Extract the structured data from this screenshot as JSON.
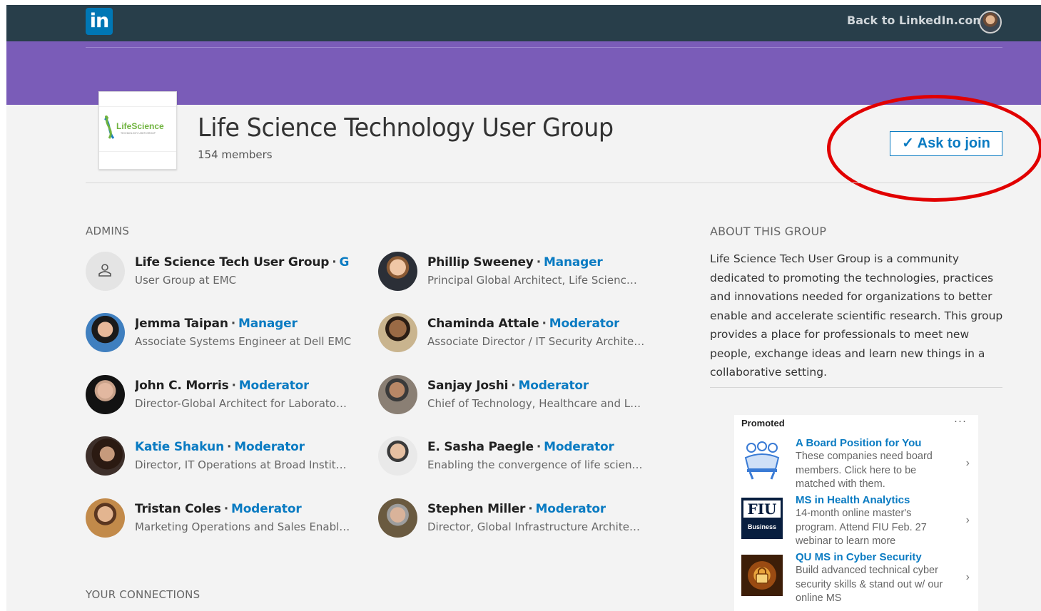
{
  "topbar": {
    "logo_text": "in",
    "back_link": "Back to LinkedIn.com"
  },
  "group": {
    "name": "Life Science Technology User Group",
    "members": "154 members",
    "join_button": "✓ Ask to join"
  },
  "sections": {
    "admins": "ADMINS",
    "about": "ABOUT THIS GROUP",
    "connections": "YOUR CONNECTIONS"
  },
  "admins": [
    {
      "name": "Life Science Tech User Group",
      "role": "Gro",
      "headline": "User Group at EMC"
    },
    {
      "name": "Phillip Sweeney",
      "role": "Manager",
      "headline": "Principal Global Architect, Life Scienc…"
    },
    {
      "name": "Jemma Taipan",
      "role": "Manager",
      "headline": "Associate Systems Engineer at Dell EMC"
    },
    {
      "name": "Chaminda Attale",
      "role": "Moderator",
      "headline": "Associate Director / IT Security Archite…"
    },
    {
      "name": "John C. Morris",
      "role": "Moderator",
      "headline": "Director-Global Architect for Laborato…"
    },
    {
      "name": "Sanjay Joshi",
      "role": "Moderator",
      "headline": "Chief of Technology, Healthcare and L…"
    },
    {
      "name": "Katie Shakun",
      "role": "Moderator",
      "headline": "Director, IT Operations at Broad Instit…"
    },
    {
      "name": "E. Sasha Paegle",
      "role": "Moderator",
      "headline": "Enabling the convergence of life scien…"
    },
    {
      "name": "Tristan Coles",
      "role": "Moderator",
      "headline": "Marketing Operations and Sales Enabl…"
    },
    {
      "name": "Stephen Miller",
      "role": "Moderator",
      "headline": "Director, Global Infrastructure Archite…"
    }
  ],
  "about_text": "Life Science Tech User Group is a community dedicated to promoting the technologies, practices and innovations needed for organizations to better enable and accelerate scientific research. This group provides a place for professionals to meet new people, exchange ideas and learn new things in a collaborative setting.",
  "ad": {
    "label": "Promoted",
    "more": "···",
    "items": [
      {
        "title": "A Board Position for You",
        "desc": "These companies need board members. Click here to be matched with them."
      },
      {
        "title": "MS in Health Analytics",
        "desc": "14-month online master's program. Attend FIU Feb. 27 webinar to learn more",
        "thumb_text": "FIU",
        "thumb_sub": "Business"
      },
      {
        "title": "QU MS in Cyber Security",
        "desc": "Build advanced technical cyber security skills & stand out w/ our online MS"
      }
    ]
  },
  "logo_card": {
    "word": "LifeScience",
    "tagline": "TECHNOLOGY USER GROUP"
  },
  "colors": {
    "topbar": "#283e4a",
    "banner": "#7a5cb8",
    "link": "#0a7bc2",
    "annotation": "#e10000"
  }
}
